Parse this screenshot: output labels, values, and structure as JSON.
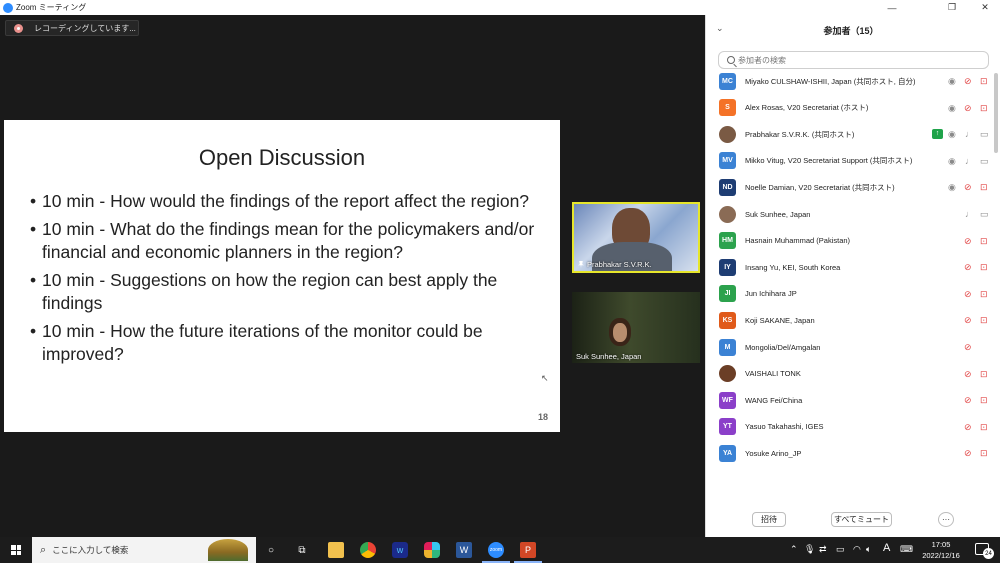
{
  "window": {
    "title": "Zoom ミーティング",
    "controls": {
      "minimize": "—",
      "maximize": "❐",
      "close": "✕"
    }
  },
  "recording": {
    "label": "レコーディングしています..."
  },
  "slide": {
    "title": "Open Discussion",
    "bullets": [
      "10 min - How would the findings of the report affect the region?",
      "10 min - What do the findings mean for the policymakers and/or financial and economic planners in the region?",
      "10 min - Suggestions on how the region can best apply the findings",
      "10 min - How the future iterations of the monitor could be improved?"
    ],
    "page_number": "18"
  },
  "videos": [
    {
      "name": "Prabhakar S.V.R.K."
    },
    {
      "name": "Suk Sunhee, Japan"
    }
  ],
  "participants_panel": {
    "title": "参加者（15）",
    "search_placeholder": "参加者の検索",
    "participants": [
      {
        "initials": "MC",
        "color": "#3b82d4",
        "name": "Miyako CULSHAW-ISHII, Japan (共同ホスト, 自分)",
        "hidden": false,
        "mic": "muted",
        "video": "off",
        "photo": false
      },
      {
        "initials": "S",
        "color": "#f47227",
        "name": "Alex Rosas, V20 Secretariat (ホスト)",
        "hidden": false,
        "mic": "muted",
        "video": "off",
        "photo": false
      },
      {
        "initials": "",
        "color": "#7a5a44",
        "name": "Prabhakar S.V.R.K. (共同ホスト)",
        "hidden": false,
        "mic": "on",
        "video": "on",
        "photo": true,
        "share": true
      },
      {
        "initials": "MV",
        "color": "#3b82d4",
        "name": "Mikko Vitug, V20 Secretariat Support (共同ホスト)",
        "hidden": false,
        "mic": "on",
        "video": "on",
        "photo": false
      },
      {
        "initials": "ND",
        "color": "#1e3d73",
        "name": "Noelle Damian, V20 Secretariat (共同ホスト)",
        "hidden": false,
        "mic": "muted",
        "video": "off",
        "photo": false
      },
      {
        "initials": "",
        "color": "#8a6b55",
        "name": "Suk Sunhee, Japan",
        "hidden": false,
        "mic": "on",
        "video": "on",
        "photo": true
      },
      {
        "initials": "HM",
        "color": "#2ca24d",
        "name": "Hasnain Muhammad (Pakistan)",
        "hidden": false,
        "mic": "muted",
        "video": "off",
        "photo": false
      },
      {
        "initials": "IY",
        "color": "#1e3d73",
        "name": "Insang Yu, KEI, South Korea",
        "hidden": false,
        "mic": "muted",
        "video": "off",
        "photo": false
      },
      {
        "initials": "JI",
        "color": "#2ca24d",
        "name": "Jun Ichihara JP",
        "hidden": false,
        "mic": "muted",
        "video": "off",
        "photo": false
      },
      {
        "initials": "KS",
        "color": "#e05a1a",
        "name": "Koji SAKANE, Japan",
        "hidden": false,
        "mic": "muted",
        "video": "off",
        "photo": false
      },
      {
        "initials": "M",
        "color": "#3b82d4",
        "name": "Mongolia/Del/Amgalan",
        "hidden": true,
        "mic": "muted",
        "video": "none",
        "photo": false
      },
      {
        "initials": "",
        "color": "#6b3e26",
        "name": "VAISHALI TONK",
        "hidden": false,
        "mic": "muted",
        "video": "off",
        "photo": true
      },
      {
        "initials": "WF",
        "color": "#8b3fc9",
        "name": "WANG Fei/China",
        "hidden": false,
        "mic": "muted",
        "video": "off",
        "photo": false
      },
      {
        "initials": "YT",
        "color": "#8b3fc9",
        "name": "Yasuo Takahashi, IGES",
        "hidden": false,
        "mic": "muted",
        "video": "off",
        "photo": false
      },
      {
        "initials": "YA",
        "color": "#3b82d4",
        "name": "Yosuke Arino_JP",
        "hidden": false,
        "mic": "muted",
        "video": "off",
        "photo": false
      }
    ],
    "footer": {
      "invite": "招待",
      "mute_all": "すべてミュート",
      "more": "···"
    }
  },
  "taskbar": {
    "search_placeholder": "ここに入力して検索",
    "ime": "A",
    "time": "17:05",
    "date": "2022/12/16",
    "notifications": "24"
  },
  "colors": {
    "muted_red": "#e24b4b",
    "share_green": "#1fa34a",
    "zoom_blue": "#2d8cff",
    "speaker_border": "#e6e62b"
  }
}
